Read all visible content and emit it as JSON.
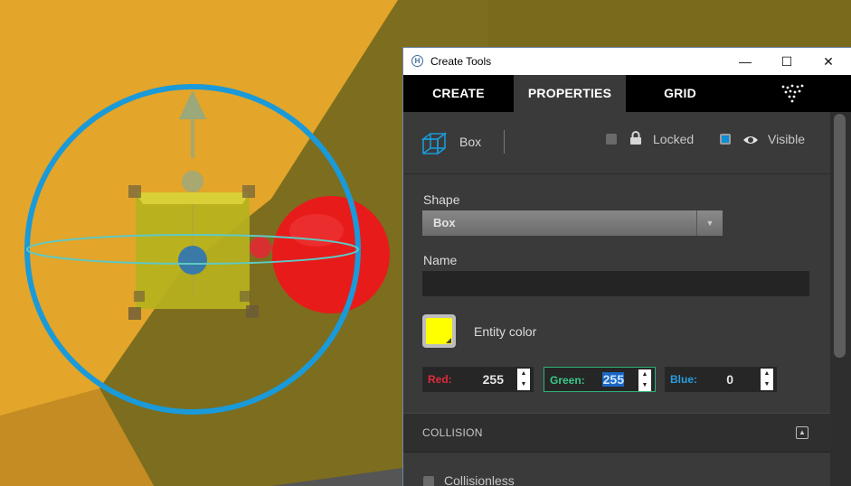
{
  "window": {
    "title": "Create Tools",
    "app_icon_letter": "H",
    "controls": {
      "minimize": "—",
      "maximize": "☐",
      "close": "✕"
    }
  },
  "tabs": [
    {
      "label": "CREATE",
      "active": false
    },
    {
      "label": "PROPERTIES",
      "active": true
    },
    {
      "label": "GRID",
      "active": false
    }
  ],
  "entity": {
    "type_label": "Box",
    "type_icon": "cube-icon",
    "locked_label": "Locked",
    "locked": false,
    "visible_label": "Visible",
    "visible": true
  },
  "shape": {
    "label": "Shape",
    "value": "Box"
  },
  "name": {
    "label": "Name",
    "value": ""
  },
  "color": {
    "label": "Entity color",
    "swatch": "#ffff00",
    "red_label": "Red:",
    "red": "255",
    "green_label": "Green:",
    "green": "255",
    "blue_label": "Blue:",
    "blue": "0"
  },
  "collision": {
    "header": "COLLISION",
    "collisionless_label": "Collisionless",
    "collisionless": false
  },
  "colors": {
    "accent": "#0a8ed6",
    "gizmo_ring": "#1a9ad8",
    "wall_yellow": "#e3a52a",
    "red_ball": "#e81b1b"
  }
}
